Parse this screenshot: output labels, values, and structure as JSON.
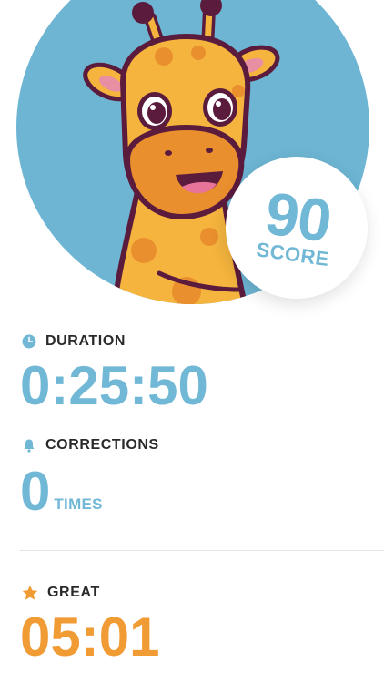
{
  "score": {
    "value": "90",
    "label": "SCORE"
  },
  "duration": {
    "label": "DURATION",
    "value": "0:25:50",
    "icon": "clock-icon"
  },
  "corrections": {
    "label": "CORRECTIONS",
    "value": "0",
    "unit": "TIMES",
    "icon": "bell-icon"
  },
  "great": {
    "label": "GREAT",
    "value": "05:01",
    "icon": "star-icon"
  },
  "colors": {
    "accent_blue": "#71b8d6",
    "accent_orange": "#f19b35",
    "text_dark": "#2a2a2a"
  }
}
